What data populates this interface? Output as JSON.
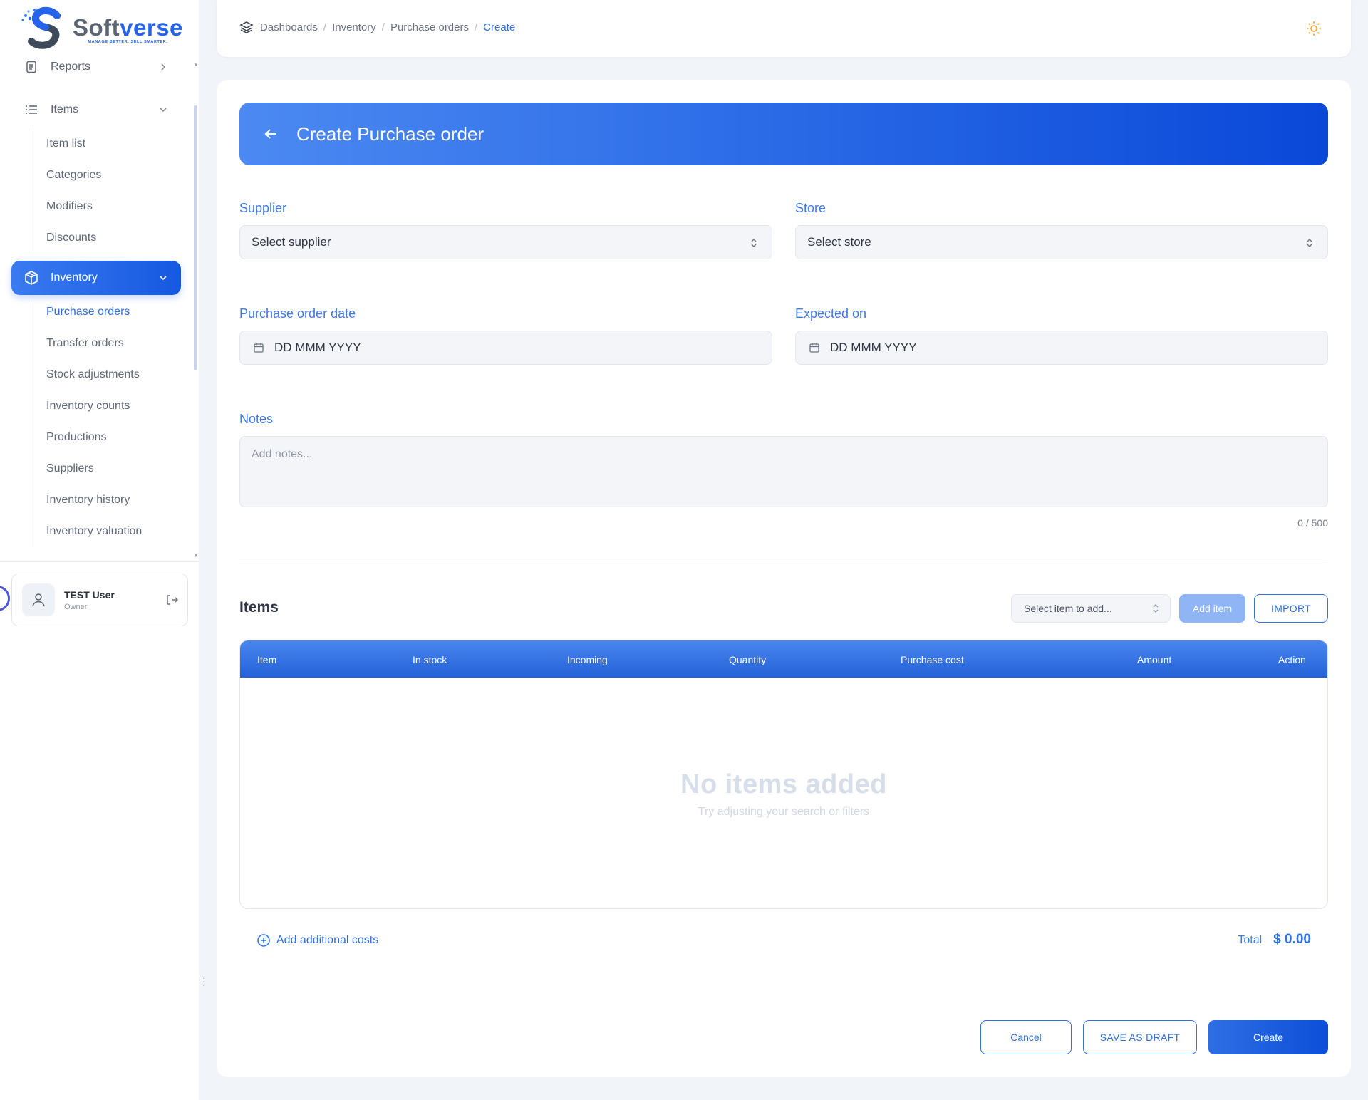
{
  "brand": {
    "name_part1": "Soft",
    "name_part2": "verse",
    "tagline": "MANAGE BETTER. SELL SMARTER.",
    "accent_color": "#2563eb"
  },
  "sidebar": {
    "reports": {
      "label": "Reports",
      "icon": "report-icon"
    },
    "items": {
      "label": "Items",
      "icon": "list-icon"
    },
    "items_sub": [
      "Item list",
      "Categories",
      "Modifiers",
      "Discounts"
    ],
    "inventory": {
      "label": "Inventory",
      "icon": "box-icon"
    },
    "inventory_sub": [
      "Purchase orders",
      "Transfer orders",
      "Stock adjustments",
      "Inventory counts",
      "Productions",
      "Suppliers",
      "Inventory history",
      "Inventory valuation"
    ],
    "user": {
      "name": "TEST User",
      "role": "Owner"
    }
  },
  "header": {
    "breadcrumb": [
      "Dashboards",
      "Inventory",
      "Purchase orders",
      "Create"
    ]
  },
  "form": {
    "title": "Create Purchase order",
    "supplier": {
      "label": "Supplier",
      "value": "Select supplier"
    },
    "store": {
      "label": "Store",
      "value": "Select store"
    },
    "po_date": {
      "label": "Purchase order date",
      "value": "DD MMM YYYY"
    },
    "expected_on": {
      "label": "Expected on",
      "value": "DD MMM YYYY"
    },
    "notes": {
      "label": "Notes",
      "placeholder": "Add notes...",
      "counter": "0 / 500"
    }
  },
  "items_section": {
    "title": "Items",
    "select_placeholder": "Select item to add...",
    "add_button": "Add item",
    "import_button": "IMPORT",
    "columns": [
      "Item",
      "In stock",
      "Incoming",
      "Quantity",
      "Purchase cost",
      "Amount",
      "Action"
    ],
    "empty_title": "No items added",
    "empty_subtitle": "Try adjusting your search or filters"
  },
  "summary": {
    "add_costs": "Add additional costs",
    "total_label": "Total",
    "total_value": "$ 0.00"
  },
  "actions": {
    "cancel": "Cancel",
    "save_draft": "SAVE AS DRAFT",
    "create": "Create"
  }
}
